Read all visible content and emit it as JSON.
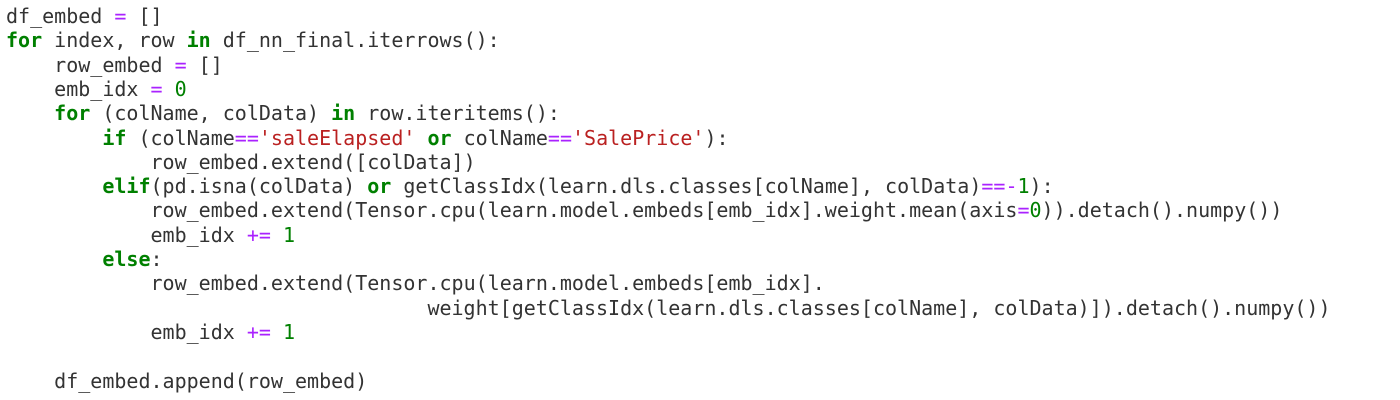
{
  "colors": {
    "keyword": "#008000",
    "operator": "#aa22ff",
    "string": "#ba2121",
    "number": "#008000",
    "text": "#333333",
    "background": "#ffffff"
  },
  "code": {
    "language": "python",
    "lines": [
      {
        "indent": "",
        "tokens": [
          [
            "plain",
            "df_embed "
          ],
          [
            "op",
            "="
          ],
          [
            "plain",
            " []"
          ]
        ]
      },
      {
        "indent": "",
        "tokens": [
          [
            "kw",
            "for"
          ],
          [
            "plain",
            " index, row "
          ],
          [
            "kw",
            "in"
          ],
          [
            "plain",
            " df_nn_final.iterrows():"
          ]
        ]
      },
      {
        "indent": "    ",
        "tokens": [
          [
            "plain",
            "row_embed "
          ],
          [
            "op",
            "="
          ],
          [
            "plain",
            " []"
          ]
        ]
      },
      {
        "indent": "    ",
        "tokens": [
          [
            "plain",
            "emb_idx "
          ],
          [
            "op",
            "="
          ],
          [
            "plain",
            " "
          ],
          [
            "num",
            "0"
          ]
        ]
      },
      {
        "indent": "    ",
        "tokens": [
          [
            "kw",
            "for"
          ],
          [
            "plain",
            " (colName, colData) "
          ],
          [
            "kw",
            "in"
          ],
          [
            "plain",
            " row.iteritems():"
          ]
        ]
      },
      {
        "indent": "        ",
        "tokens": [
          [
            "kw",
            "if"
          ],
          [
            "plain",
            " (colName"
          ],
          [
            "op",
            "=="
          ],
          [
            "str",
            "'saleElapsed'"
          ],
          [
            "plain",
            " "
          ],
          [
            "kw",
            "or"
          ],
          [
            "plain",
            " colName"
          ],
          [
            "op",
            "=="
          ],
          [
            "str",
            "'SalePrice'"
          ],
          [
            "plain",
            "):"
          ]
        ]
      },
      {
        "indent": "            ",
        "tokens": [
          [
            "plain",
            "row_embed.extend([colData])"
          ]
        ]
      },
      {
        "indent": "        ",
        "tokens": [
          [
            "kw",
            "elif"
          ],
          [
            "plain",
            "(pd.isna(colData) "
          ],
          [
            "kw",
            "or"
          ],
          [
            "plain",
            " getClassIdx(learn.dls.classes[colName], colData)"
          ],
          [
            "op",
            "=="
          ],
          [
            "op",
            "-"
          ],
          [
            "num",
            "1"
          ],
          [
            "plain",
            "):"
          ]
        ]
      },
      {
        "indent": "            ",
        "tokens": [
          [
            "plain",
            "row_embed.extend(Tensor.cpu(learn.model.embeds[emb_idx].weight.mean(axis"
          ],
          [
            "op",
            "="
          ],
          [
            "num",
            "0"
          ],
          [
            "plain",
            ")).detach().numpy())"
          ]
        ]
      },
      {
        "indent": "            ",
        "tokens": [
          [
            "plain",
            "emb_idx "
          ],
          [
            "op",
            "+="
          ],
          [
            "plain",
            " "
          ],
          [
            "num",
            "1"
          ]
        ]
      },
      {
        "indent": "        ",
        "tokens": [
          [
            "kw",
            "else"
          ],
          [
            "plain",
            ":"
          ]
        ]
      },
      {
        "indent": "            ",
        "tokens": [
          [
            "plain",
            "row_embed.extend(Tensor.cpu(learn.model.embeds[emb_idx]."
          ]
        ]
      },
      {
        "indent": "                                   ",
        "tokens": [
          [
            "plain",
            "weight[getClassIdx(learn.dls.classes[colName], colData)]).detach().numpy())"
          ]
        ]
      },
      {
        "indent": "            ",
        "tokens": [
          [
            "plain",
            "emb_idx "
          ],
          [
            "op",
            "+="
          ],
          [
            "plain",
            " "
          ],
          [
            "num",
            "1"
          ]
        ]
      },
      {
        "indent": "",
        "tokens": []
      },
      {
        "indent": "    ",
        "tokens": [
          [
            "plain",
            "df_embed.append(row_embed)"
          ]
        ]
      }
    ]
  }
}
